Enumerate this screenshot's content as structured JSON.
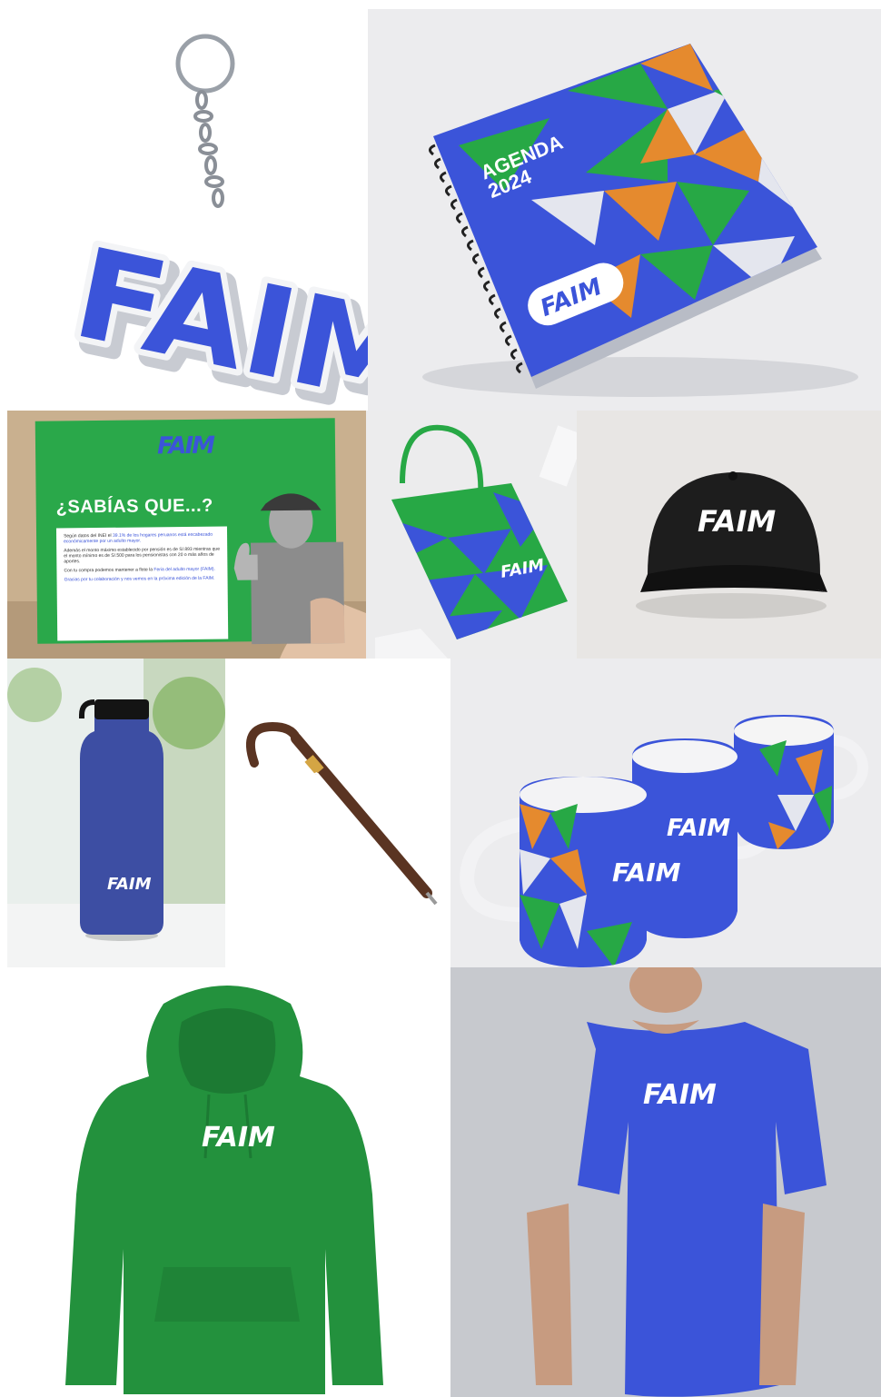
{
  "brand": {
    "logo_text": "FAIM",
    "colors": {
      "blue": "#3b54d9",
      "green": "#27a845",
      "orange": "#e58a2e",
      "light": "#e4e6ee",
      "black": "#1a1a1a"
    }
  },
  "agenda": {
    "title_line1": "AGENDA",
    "title_line2": "2024"
  },
  "flyer": {
    "heading": "¿SABÍAS QUE...?",
    "paragraphs": [
      {
        "lead": "Según datos del INEI el ",
        "highlight": "39.1% de los hogares peruanos está encabezado económicamente por un adulto mayor."
      },
      {
        "lead": "Además el monto máximo establecido por pensión es de S/.893 mientras que el monto mínimo es de S/.500 para los pensionistas con 20 o más años de aportes.",
        "highlight": ""
      },
      {
        "lead": "Con tu compra podemos mantener a flote la ",
        "highlight": "Feria del adulto mayor (FAIM)."
      },
      {
        "lead": "",
        "highlight": "Gracias por tu colaboración y nos vemos en la próxima edición de la FAIM."
      }
    ]
  },
  "items": [
    {
      "id": "keychain",
      "icon": "keychain"
    },
    {
      "id": "agenda",
      "icon": "notebook"
    },
    {
      "id": "flyer",
      "icon": "flyer"
    },
    {
      "id": "tote",
      "icon": "tote-bag"
    },
    {
      "id": "cap",
      "icon": "cap"
    },
    {
      "id": "bottle",
      "icon": "water-bottle"
    },
    {
      "id": "pen",
      "icon": "pen"
    },
    {
      "id": "mugs",
      "icon": "mugs"
    },
    {
      "id": "hoodie",
      "icon": "hoodie"
    },
    {
      "id": "tshirt",
      "icon": "t-shirt"
    }
  ]
}
